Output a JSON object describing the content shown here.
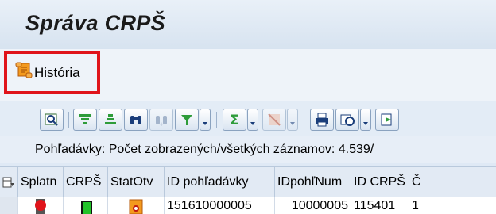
{
  "title": "Správa CRPŠ",
  "app_toolbar": {
    "history_label": "História"
  },
  "alv_toolbar": {
    "buttons": [
      "details-icon",
      "sort-ascending-icon",
      "sort-descending-icon",
      "find-icon",
      "find-next-icon",
      "filter-icon",
      "total-icon",
      "subtotal-icon",
      "print-icon",
      "view-icon",
      "export-icon"
    ]
  },
  "info": {
    "text": "Pohľadávky: Počet zobrazených/všetkých záznamov: 4.539/"
  },
  "table": {
    "columns": [
      "Splatn",
      "CRPŠ",
      "StatOtv",
      "ID pohľadávky",
      "IDpohľNum",
      "ID CRPŠ",
      "Č"
    ],
    "rows": [
      {
        "splatn_status": "red",
        "crps_status": "green",
        "stat_otv": "lock-icon",
        "id_pohladavky": "151610000005",
        "id_pohl_num": "10000005",
        "id_crps": "115401",
        "c": "1"
      }
    ]
  },
  "colors": {
    "highlight_border": "#e0141b",
    "traffic_red": "#e0141b",
    "traffic_green": "#22c22a"
  }
}
